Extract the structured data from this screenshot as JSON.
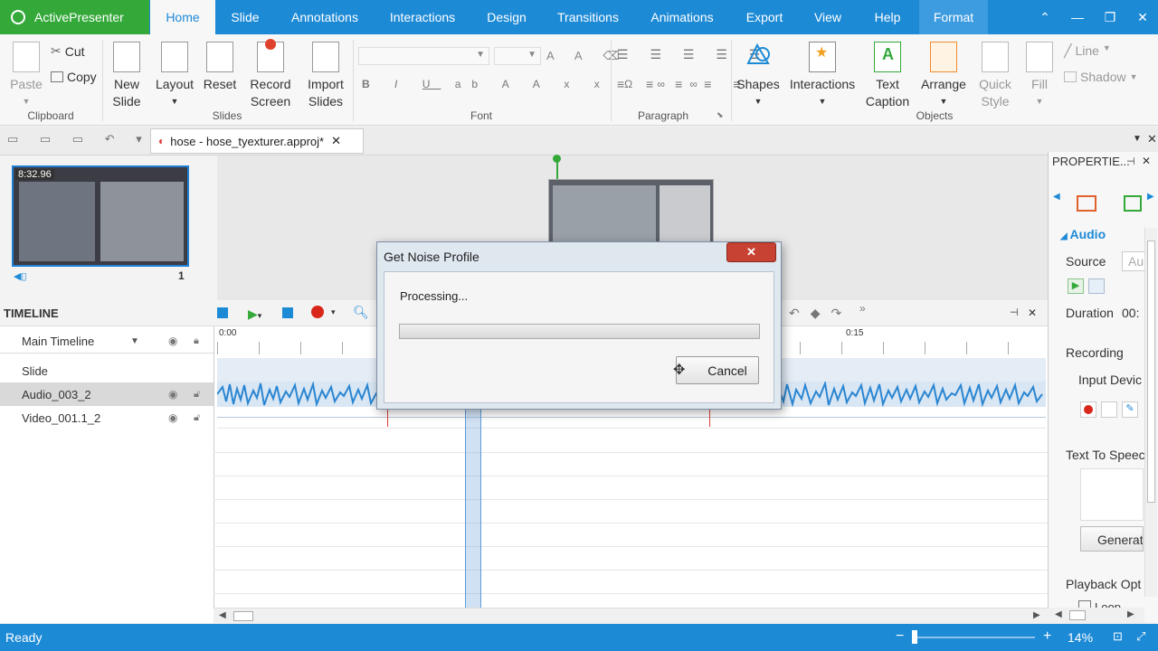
{
  "app": {
    "name": "ActivePresenter"
  },
  "menu_tabs": [
    "Home",
    "Slide",
    "Annotations",
    "Interactions",
    "Design",
    "Transitions",
    "Animations",
    "Export",
    "View",
    "Help",
    "Format"
  ],
  "ribbon": {
    "clipboard": {
      "paste": "Paste",
      "cut": "Cut",
      "copy": "Copy",
      "group": "Clipboard"
    },
    "slides": {
      "new_slide": "New Slide",
      "layout": "Layout",
      "reset": "Reset",
      "record_screen": "Record Screen",
      "import_slides": "Import Slides",
      "group": "Slides"
    },
    "font": {
      "group": "Font"
    },
    "paragraph": {
      "group": "Paragraph"
    },
    "objects": {
      "shapes": "Shapes",
      "interactions": "Interactions",
      "text_caption": "Text Caption",
      "arrange": "Arrange",
      "quick_style": "Quick Style",
      "fill": "Fill",
      "line": "Line",
      "shadow": "Shadow",
      "group": "Objects"
    }
  },
  "document_tab": {
    "title": "hose - hose_tyexturer.approj*"
  },
  "slide_thumb": {
    "duration": "8:32.96",
    "number": "1"
  },
  "timeline": {
    "title": "TIMELINE",
    "main_label": "Main Timeline",
    "ruler": [
      "0:00",
      "0:15"
    ],
    "rows": [
      "Slide",
      "Audio_003_2",
      "Video_001.1_2"
    ]
  },
  "properties": {
    "title": "PROPERTIE...",
    "section": "Audio",
    "source": "Source",
    "source_value": "Au",
    "duration": "Duration",
    "duration_value": "00:",
    "recording": "Recording",
    "input_device": "Input Devic",
    "tts": "Text To Speec",
    "generate": "Generat",
    "playback": "Playback Opt",
    "loop": "Loop"
  },
  "dialog": {
    "title": "Get Noise Profile",
    "message": "Processing...",
    "cancel": "Cancel",
    "progress": 0.0
  },
  "status": {
    "text": "Ready",
    "zoom": "14%"
  },
  "colors": {
    "accent": "#1d8ad6",
    "app_green": "#34a93a",
    "waveform": "#2b86d1"
  }
}
